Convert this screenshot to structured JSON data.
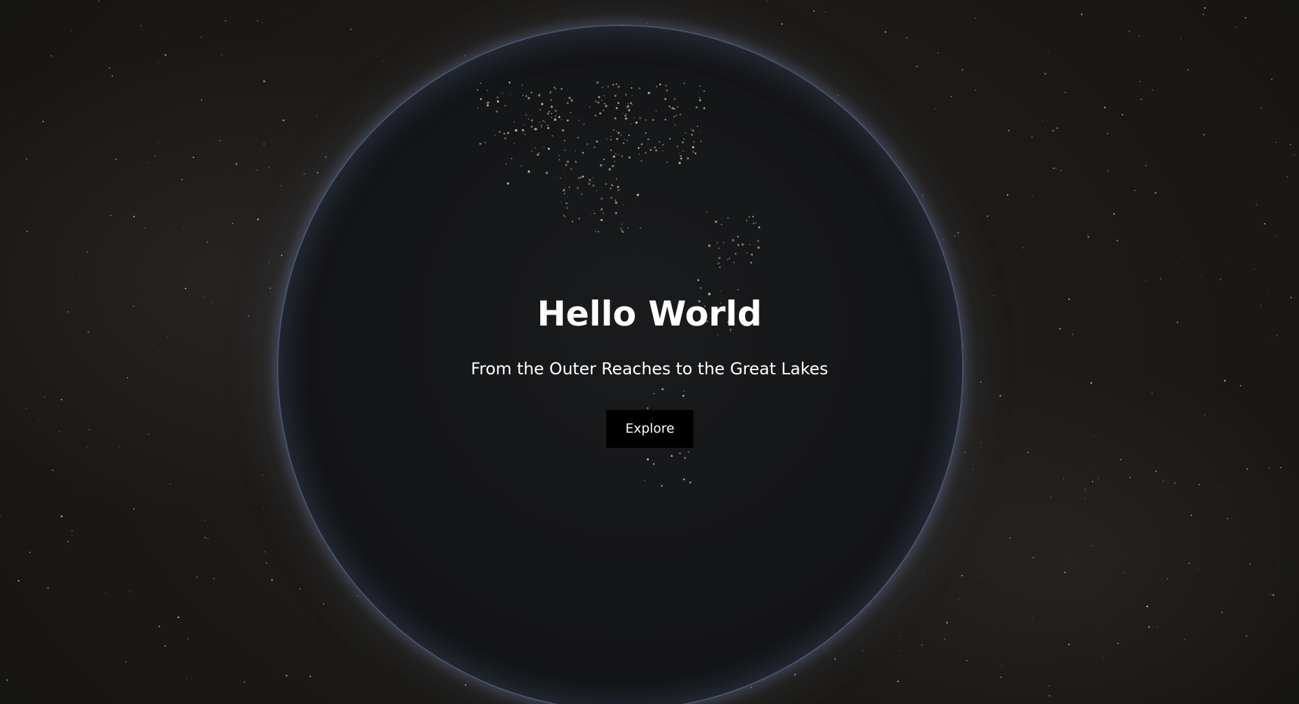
{
  "hero": {
    "title": "Hello World",
    "subtitle": "From the Outer Reaches to the Great Lakes",
    "button_label": "Explore"
  },
  "background": {
    "image": "earth-at-night",
    "colors": {
      "space": "#1c1a17",
      "globe": "#141517",
      "atmosphere": "#6e7da0",
      "text": "#ffffff",
      "button": "#000000"
    }
  }
}
